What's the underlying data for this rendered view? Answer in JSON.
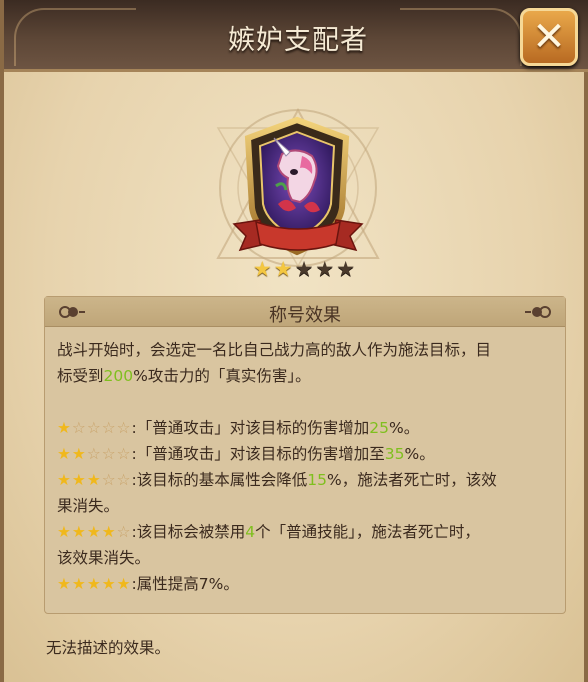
{
  "title": "嫉妒支配者",
  "close_label": "✕",
  "badge": {
    "icon": "unicorn-emblem-icon",
    "stars_filled": 2,
    "stars_total": 5
  },
  "effect": {
    "header": "称号效果",
    "intro_a": "战斗开始时，会选定一名比自己战力高的敌人作为施法目标，目",
    "intro_b1": "标受到",
    "intro_hl": "200",
    "intro_b2": "%攻击力的「真实伤害」。",
    "levels": [
      {
        "stars": "★☆☆☆☆",
        "pre": ":「普通攻击」对该目标的伤害增加",
        "hl": "25",
        "post": "%。"
      },
      {
        "stars": "★★☆☆☆",
        "pre": ":「普通攻击」对该目标的伤害增加至",
        "hl": "35",
        "post": "%。"
      },
      {
        "stars": "★★★☆☆",
        "pre": ":该目标的基本属性会降低",
        "hl": "15",
        "post": "%，施法者死亡时，该效",
        "cont": "果消失。"
      },
      {
        "stars": "★★★★☆",
        "pre": ":该目标会被禁用",
        "hl": "4",
        "post": "个「普通技能」，施法者死亡时，",
        "cont": "该效果消失。"
      },
      {
        "stars": "★★★★★",
        "pre": ":属性提高7%。"
      }
    ]
  },
  "footer": "无法描述的效果。",
  "colors": {
    "highlight": "#7fbf1e",
    "star": "#f4c741",
    "close": "#d98a32"
  }
}
